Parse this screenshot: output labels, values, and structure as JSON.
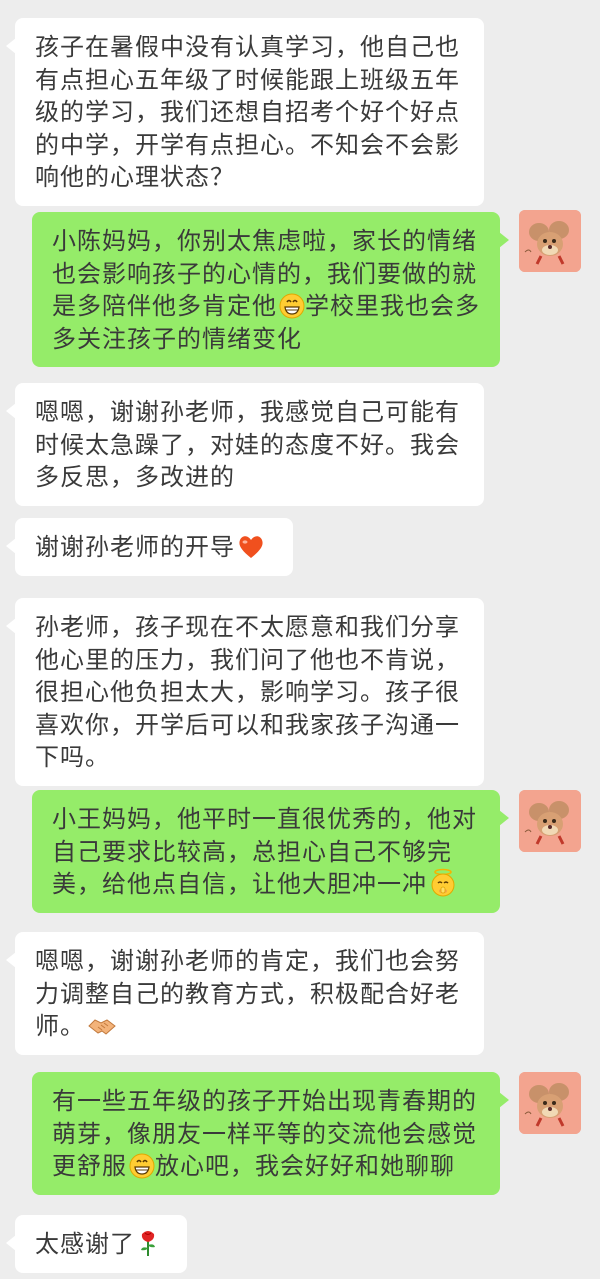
{
  "messages": [
    {
      "side": "in",
      "text": "孩子在暑假中没有认真学习，他自己也有点担心五年级了时候能跟上班级五年级的学习，我们还想自招考个好个好点的中学，开学有点担心。不知会不会影响他的心理状态？"
    },
    {
      "side": "out",
      "text": "小陈妈妈，你别太焦虑啦，家长的情绪也会影响孩子的心情的，我们要做的就是多陪伴他多肯定他",
      "emoji": "grin-emoji",
      "text2": "学校里我也会多多关注孩子的情绪变化"
    },
    {
      "side": "in",
      "text": "嗯嗯，谢谢孙老师，我感觉自己可能有时候太急躁了，对娃的态度不好。我会多反思，多改进的"
    },
    {
      "side": "in",
      "text": "谢谢孙老师的开导",
      "emoji": "heart-emoji"
    },
    {
      "side": "in",
      "text": "孙老师，孩子现在不太愿意和我们分享他心里的压力，我们问了他也不肯说，很担心他负担太大，影响学习。孩子很喜欢你，开学后可以和我家孩子沟通一下吗。"
    },
    {
      "side": "out",
      "text": "小王妈妈，他平时一直很优秀的，他对自己要求比较高，总担心自己不够完美，给他点自信，让他大胆冲一冲",
      "emoji": "halo-hush-emoji"
    },
    {
      "side": "in",
      "text": "嗯嗯，谢谢孙老师的肯定，我们也会努力调整自己的教育方式，积极配合好老师。",
      "emoji": "handshake-emoji"
    },
    {
      "side": "out",
      "text": "有一些五年级的孩子开始出现青春期的萌芽，像朋友一样平等的交流他会感觉更舒服",
      "emoji": "grin-emoji",
      "text2": "放心吧，我会好好和她聊聊"
    },
    {
      "side": "in",
      "text": "太感谢了",
      "emoji": "rose-emoji"
    }
  ],
  "colors": {
    "background": "#ededed",
    "incoming": "#ffffff",
    "outgoing": "#95ec69",
    "avatar": "#f3a48f"
  }
}
